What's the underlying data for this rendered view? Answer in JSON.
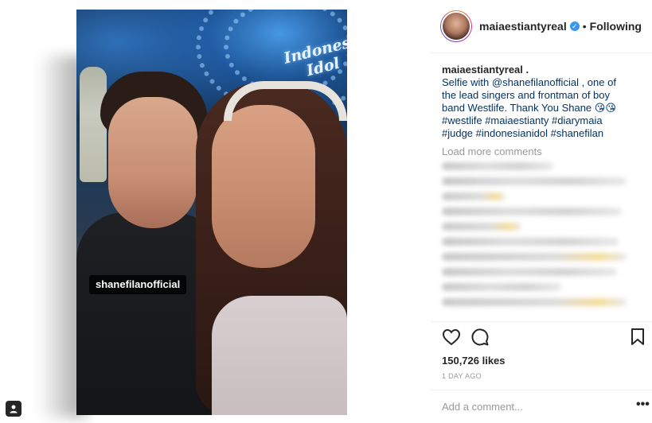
{
  "post": {
    "tag_label": "shanefilanofficial",
    "logo_line1": "Indonesia",
    "logo_line2": "Idol"
  },
  "header": {
    "username": "maiaestiantyreal",
    "separator": "•",
    "follow_status": "Following"
  },
  "caption": {
    "username": "maiaestiantyreal",
    "after_user": ".",
    "line_prefix": "Selfie with ",
    "mention": "@shanefilanofficial",
    "body": " , one of the lead singers and frontman of boy band Westlife. Thank You Shane 😘😘",
    "hashtags": "#westlife #maiaestianty #diarymaia #judge #indonesianidol #shanefilan"
  },
  "comments": {
    "load_more": "Load more comments"
  },
  "stats": {
    "likes": "150,726 likes",
    "time": "1 DAY AGO"
  },
  "comment_box": {
    "placeholder": "Add a comment...",
    "more": "•••"
  },
  "icons": [
    "heart-icon",
    "comment-icon",
    "bookmark-icon",
    "user-tag-icon",
    "verified-icon"
  ],
  "colors": {
    "link": "#003569",
    "verified": "#3897f0",
    "muted": "#999999",
    "text": "#262626"
  }
}
